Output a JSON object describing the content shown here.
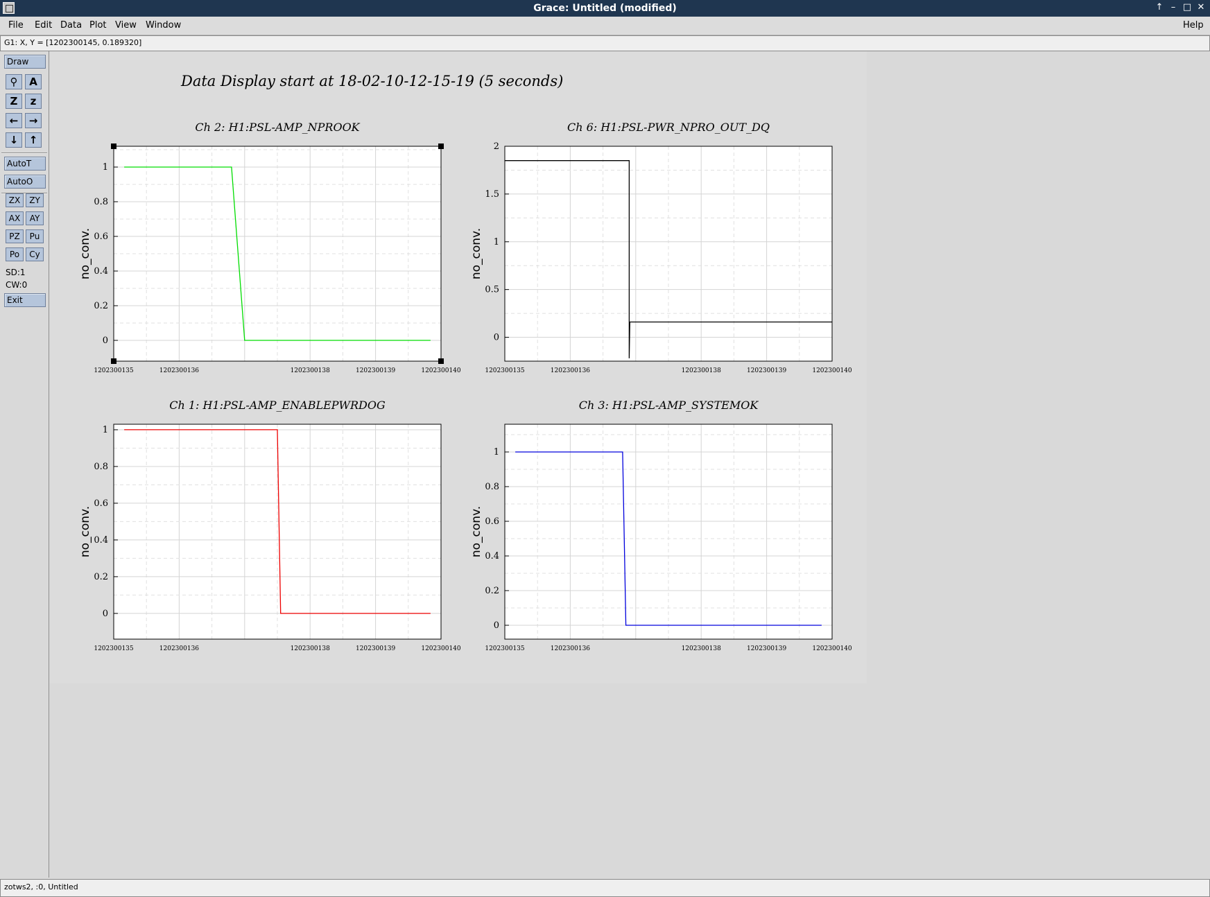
{
  "window": {
    "title": "Grace: Untitled (modified)",
    "controls": [
      "↑",
      "–",
      "□",
      "✕"
    ]
  },
  "menubar": {
    "items": [
      "File",
      "Edit",
      "Data",
      "Plot",
      "View",
      "Window"
    ],
    "help": "Help"
  },
  "locator": {
    "text": "G1: X, Y = [1202300145, 0.189320]"
  },
  "toolbox": {
    "draw": "Draw",
    "icon_buttons": [
      {
        "name": "magnify-icon",
        "glyph": "⚲"
      },
      {
        "name": "text-icon",
        "glyph": "A"
      },
      {
        "name": "zoom-in-icon",
        "glyph": "Z"
      },
      {
        "name": "zoom-out-icon",
        "glyph": "z"
      },
      {
        "name": "arrow-left-icon",
        "glyph": "←"
      },
      {
        "name": "arrow-right-icon",
        "glyph": "→"
      },
      {
        "name": "arrow-down-icon",
        "glyph": "↓"
      },
      {
        "name": "arrow-up-icon",
        "glyph": "↑"
      }
    ],
    "autot": "AutoT",
    "autoo": "AutoO",
    "small_buttons": [
      "ZX",
      "ZY",
      "AX",
      "AY",
      "PZ",
      "Pu",
      "Po",
      "Cy"
    ],
    "sd": "SD:1",
    "cw": "CW:0",
    "exit": "Exit"
  },
  "statusbar": {
    "text": "zotws2, :0, Untitled"
  },
  "page_title": "Data Display start at 18-02-10-12-15-19 (5 seconds)",
  "chart_data": [
    {
      "type": "line",
      "title": "Ch 2: H1:PSL-AMP_NPROOK",
      "ylabel": "no_conv.",
      "xlabel": "",
      "color": "#00dd00",
      "xlim": [
        1202300135,
        1202300140
      ],
      "ylim": [
        -0.12,
        1.12
      ],
      "yticks": [
        0,
        0.2,
        0.4,
        0.6,
        0.8,
        1
      ],
      "ytick_labels": [
        "0",
        "0.2",
        "0.4",
        "0.6",
        "0.8",
        "1"
      ],
      "xticks": [
        1202300135,
        1202300136,
        1202300138,
        1202300139,
        1202300140
      ],
      "xtick_labels": [
        "1202300135",
        "1202300136",
        "1202300138",
        "1202300139",
        "1202300140"
      ],
      "x": [
        1202300135.16,
        1202300136.8,
        1202300137.0,
        1202300139.84
      ],
      "y": [
        1,
        1,
        0,
        0
      ],
      "selected": true
    },
    {
      "type": "line",
      "title": "Ch 6: H1:PSL-PWR_NPRO_OUT_DQ",
      "ylabel": "no_conv.",
      "xlabel": "",
      "color": "#000000",
      "xlim": [
        1202300135,
        1202300140
      ],
      "ylim": [
        -0.25,
        2
      ],
      "yticks": [
        0,
        0.5,
        1,
        1.5,
        2
      ],
      "ytick_labels": [
        "0",
        "0.5",
        "1",
        "1.5",
        "2"
      ],
      "xticks": [
        1202300135,
        1202300136,
        1202300138,
        1202300139,
        1202300140
      ],
      "xtick_labels": [
        "1202300135",
        "1202300136",
        "1202300138",
        "1202300139",
        "1202300140"
      ],
      "x": [
        1202300135,
        1202300136.9,
        1202300136.9,
        1202300136.91,
        1202300136.92,
        1202300140
      ],
      "y": [
        1.85,
        1.85,
        -0.22,
        0.16,
        0.16,
        0.16
      ],
      "selected": false
    },
    {
      "type": "line",
      "title": "Ch 1: H1:PSL-AMP_ENABLEPWRDOG",
      "ylabel": "no_conv.",
      "xlabel": "",
      "color": "#ee0000",
      "xlim": [
        1202300135,
        1202300140
      ],
      "ylim": [
        -0.14,
        1.03
      ],
      "yticks": [
        0,
        0.2,
        0.4,
        0.6,
        0.8,
        1
      ],
      "ytick_labels": [
        "0",
        "0.2",
        "0.4",
        "0.6",
        "0.8",
        "1"
      ],
      "xticks": [
        1202300135,
        1202300136,
        1202300138,
        1202300139,
        1202300140
      ],
      "xtick_labels": [
        "1202300135",
        "1202300136",
        "1202300138",
        "1202300139",
        "1202300140"
      ],
      "x": [
        1202300135.16,
        1202300137.5,
        1202300137.55,
        1202300139.84
      ],
      "y": [
        1,
        1,
        0,
        0
      ],
      "selected": false
    },
    {
      "type": "line",
      "title": "Ch 3: H1:PSL-AMP_SYSTEMOK",
      "ylabel": "no_conv.",
      "xlabel": "",
      "color": "#0000dd",
      "xlim": [
        1202300135,
        1202300140
      ],
      "ylim": [
        -0.08,
        1.16
      ],
      "yticks": [
        0,
        0.2,
        0.4,
        0.6,
        0.8,
        1
      ],
      "ytick_labels": [
        "0",
        "0.2",
        "0.4",
        "0.6",
        "0.8",
        "1"
      ],
      "xticks": [
        1202300135,
        1202300136,
        1202300138,
        1202300139,
        1202300140
      ],
      "xtick_labels": [
        "1202300135",
        "1202300136",
        "1202300138",
        "1202300139",
        "1202300140"
      ],
      "x": [
        1202300135.16,
        1202300136.8,
        1202300136.85,
        1202300139.84
      ],
      "y": [
        1,
        1,
        0,
        0
      ],
      "selected": false
    }
  ]
}
